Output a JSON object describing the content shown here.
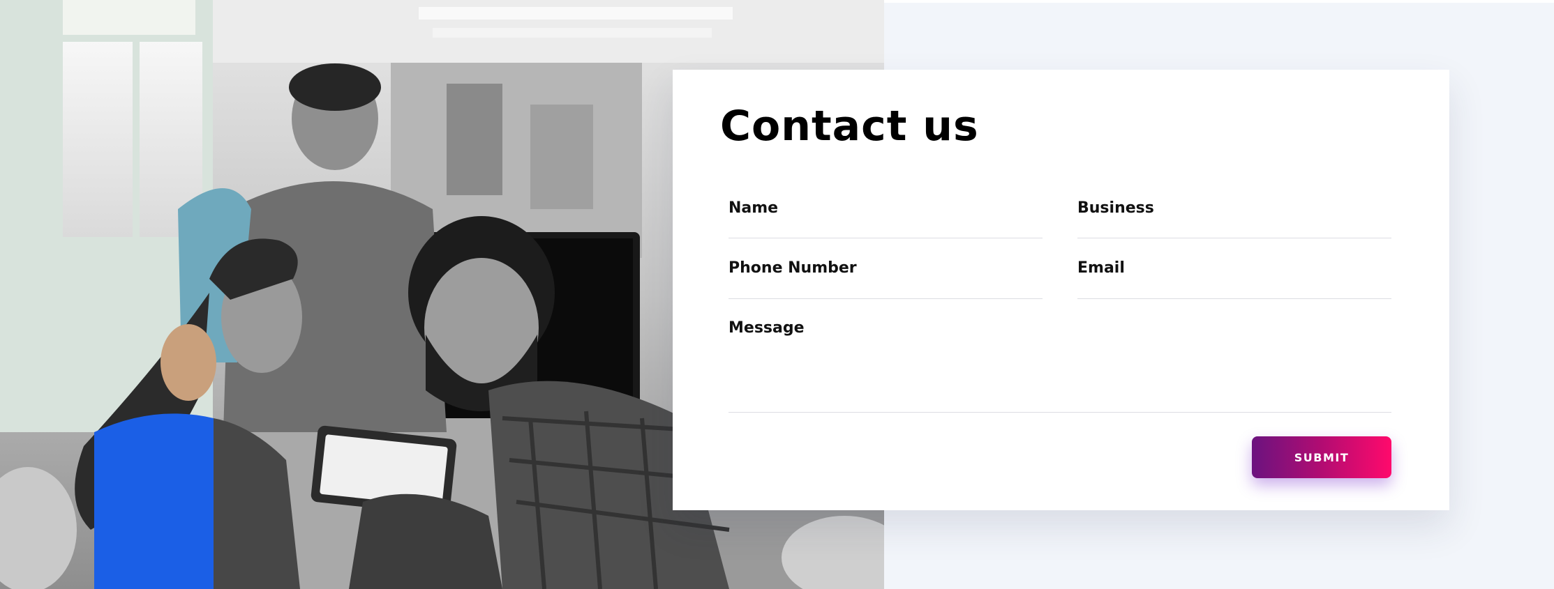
{
  "contact": {
    "title": "Contact us",
    "fields": {
      "name": {
        "label": "Name",
        "value": ""
      },
      "business": {
        "label": "Business",
        "value": ""
      },
      "phone": {
        "label": "Phone Number",
        "value": ""
      },
      "email": {
        "label": "Email",
        "value": ""
      },
      "message": {
        "label": "Message",
        "value": ""
      }
    },
    "submit_label": "SUBMIT"
  },
  "colors": {
    "background_right": "#f2f5fa",
    "card": "#ffffff",
    "button_gradient_start": "#6b137f",
    "button_gradient_end": "#ff0a6c",
    "accent_blue_shirt": "#1b5fe6"
  },
  "photo": {
    "subject": "team-photo"
  }
}
